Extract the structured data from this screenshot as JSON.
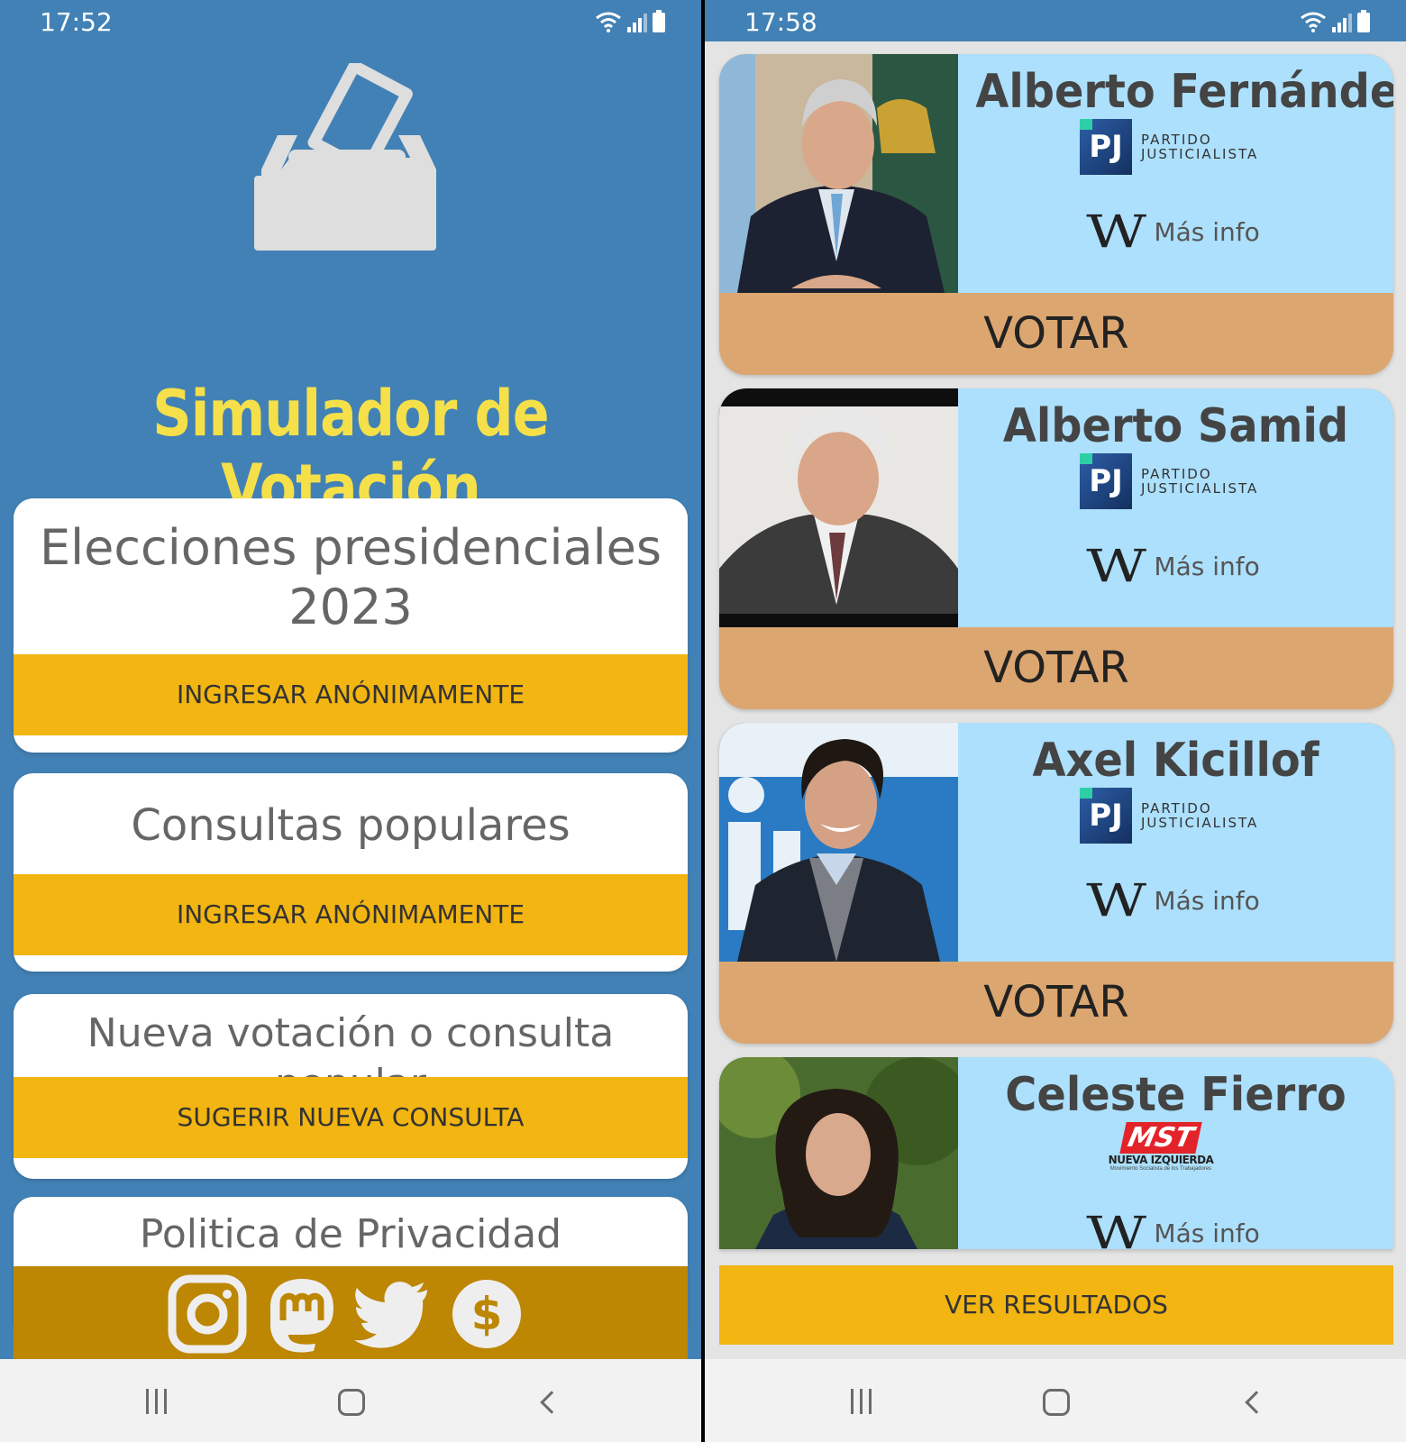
{
  "left_screen": {
    "status": {
      "time": "17:52"
    },
    "app_title": "Simulador de Votación",
    "cards": [
      {
        "title": "Elecciones presidenciales 2023",
        "action": "INGRESAR ANÓNIMAMENTE"
      },
      {
        "title": "Consultas populares",
        "action": "INGRESAR ANÓNIMAMENTE"
      },
      {
        "title": "Nueva votación o consulta popular",
        "action": "SUGERIR NUEVA CONSULTA"
      },
      {
        "title": "Politica de Privacidad"
      }
    ],
    "social_icons": [
      "instagram-icon",
      "mastodon-icon",
      "twitter-icon",
      "dollar-icon"
    ]
  },
  "right_screen": {
    "status": {
      "time": "17:58"
    },
    "candidates": [
      {
        "name": "Alberto Fernández",
        "party_abbr": "PJ",
        "party_line1": "PARTIDO",
        "party_line2": "JUSTICIALISTA",
        "info_label": "Más info",
        "vote_label": "VOTAR"
      },
      {
        "name": "Alberto Samid",
        "party_abbr": "PJ",
        "party_line1": "PARTIDO",
        "party_line2": "JUSTICIALISTA",
        "info_label": "Más info",
        "vote_label": "VOTAR"
      },
      {
        "name": "Axel Kicillof",
        "party_abbr": "PJ",
        "party_line1": "PARTIDO",
        "party_line2": "JUSTICIALISTA",
        "info_label": "Más info",
        "vote_label": "VOTAR"
      },
      {
        "name": "Celeste Fierro",
        "party_abbr": "MST",
        "party_line1": "NUEVA IZQUIERDA",
        "party_line2": "Movimiento Socialista de los Trabajadores",
        "info_label": "Más info"
      }
    ],
    "results_button": "VER RESULTADOS"
  },
  "colors": {
    "primary_blue": "#4281b5",
    "title_yellow": "#f5e04a",
    "button_yellow": "#f2b511",
    "social_gold": "#bd8603",
    "card_light_blue": "#ace0fc",
    "vote_tan": "#dca670",
    "pj_blue": "#2d5ea8",
    "mst_red": "#e3232a"
  },
  "icons": [
    "ballot-box-icon",
    "wikipedia-icon",
    "wifi-icon",
    "signal-icon",
    "battery-icon",
    "recent-apps-icon",
    "home-icon",
    "back-icon"
  ]
}
